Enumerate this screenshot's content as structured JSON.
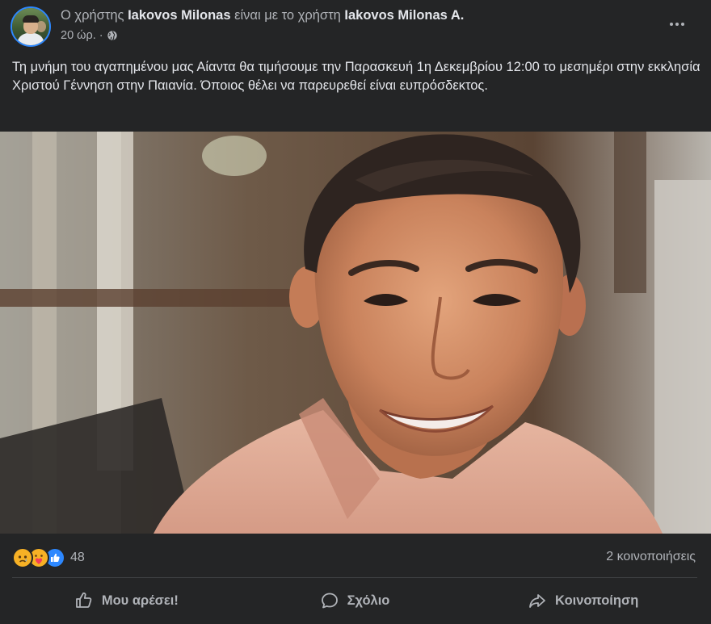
{
  "post": {
    "header": {
      "prefix": "Ο χρήστης",
      "author": "Iakovos Milonas",
      "middle": "είναι με το χρήστη",
      "tagged": "Iakovos Milonas A.",
      "time": "20 ώρ. ·",
      "privacy_icon": "globe-icon"
    },
    "text": "Τη μνήμη του αγαπημένου μας Αίαντα θα τιμήσουμε την Παρασκευή 1η Δεκεμβρίου 12:00 το μεσημέρι στην εκκλησία Χριστού Γέννηση στην Παιανία. Όποιος θέλει να παρευρεθεί είναι ευπρόσδεκτος.",
    "reactions": {
      "icons": [
        "sad-icon",
        "care-icon",
        "like-icon"
      ],
      "count": "48"
    },
    "shares": "2 κοινοποιήσεις",
    "actions": {
      "like": "Μου αρέσει!",
      "comment": "Σχόλιο",
      "share": "Κοινοποίηση"
    }
  },
  "colors": {
    "background": "#242526",
    "text_primary": "#e4e6eb",
    "text_secondary": "#b0b3b8",
    "accent": "#2d88ff"
  }
}
